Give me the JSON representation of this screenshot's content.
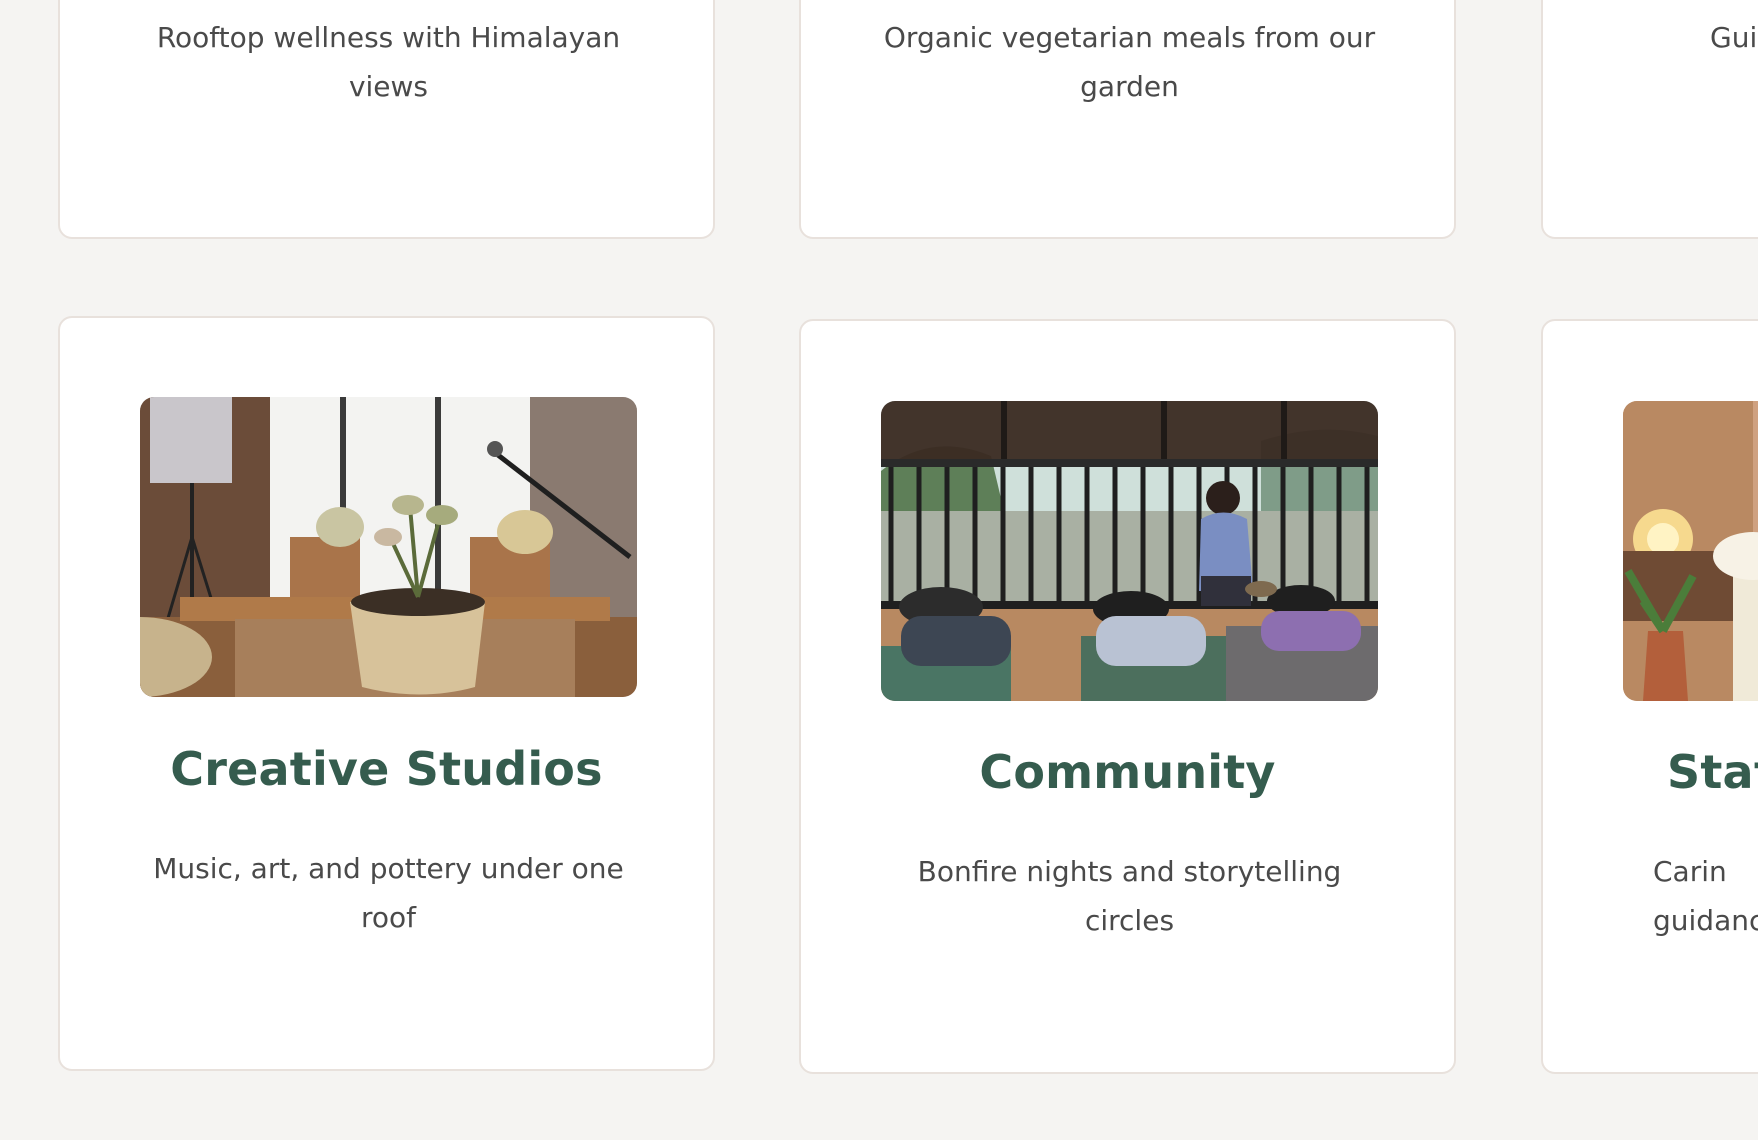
{
  "cards_top": [
    {
      "desc": "Rooftop wellness with Himalayan views"
    },
    {
      "desc": "Organic vegetarian meals from our garden"
    },
    {
      "desc": "Guided"
    }
  ],
  "cards_bottom": [
    {
      "title": "Creative Studios",
      "desc": "Music, art, and pottery under one roof",
      "image": "studio-photo"
    },
    {
      "title": "Community",
      "desc": "Bonfire nights and storytelling circles",
      "image": "sound-bath-photo"
    },
    {
      "title": "Staf",
      "desc": "Carin guidanc",
      "image": "bedroom-photo"
    }
  ]
}
